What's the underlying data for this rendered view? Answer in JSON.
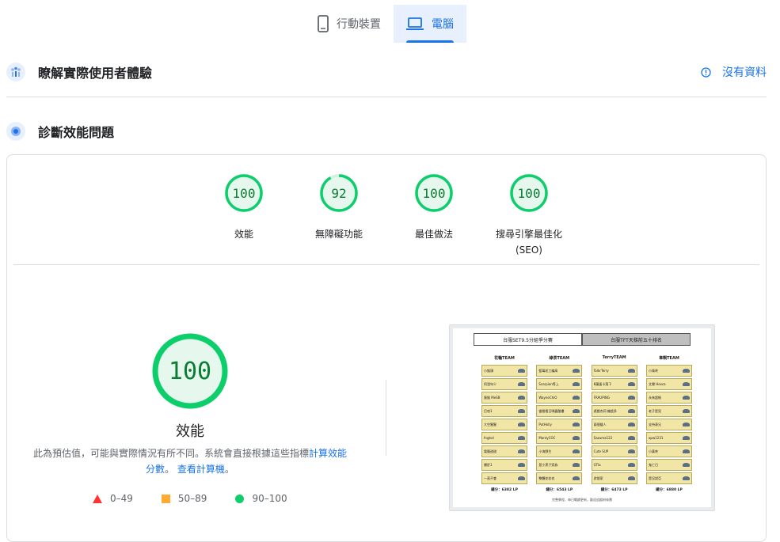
{
  "tabs": [
    {
      "label": "行動裝置",
      "icon": "phone-icon",
      "active": false
    },
    {
      "label": "電腦",
      "icon": "laptop-icon",
      "active": true
    }
  ],
  "field_section": {
    "title": "瞭解實際使用者體驗",
    "status": "沒有資料"
  },
  "lab_section": {
    "title": "診斷效能問題"
  },
  "gauges": [
    {
      "score": "100",
      "label": "效能",
      "value": 100
    },
    {
      "score": "92",
      "label": "無障礙功能",
      "value": 92
    },
    {
      "score": "100",
      "label": "最佳做法",
      "value": 100
    },
    {
      "score": "100",
      "label": "搜尋引擎最佳化",
      "sublabel": "(SEO)",
      "value": 100
    }
  ],
  "main_score": {
    "score": "100",
    "label": "效能",
    "value": 100
  },
  "note": {
    "text": "此為預估值，可能與實際情況有所不同。系統會直接根據這些指標",
    "link1": "計算效能分數",
    "mid": "。",
    "link2": "查看計算機",
    "end": "。"
  },
  "legend": [
    {
      "range": "0–49",
      "color": "#ff3333",
      "shape": "triangle"
    },
    {
      "range": "50–89",
      "color": "#ffaa33",
      "shape": "square"
    },
    {
      "range": "90–100",
      "color": "#0cce6b",
      "shape": "circle"
    }
  ],
  "screenshot": {
    "tab_active": "台服SET9.5分組爭分賽",
    "tab_inactive": "台服TFT天梯前五十排名",
    "teams": [
      {
        "name": "花輪TEAM",
        "total": "總分：6382 LP",
        "players": [
          "小猴頭",
          "阿澄年少",
          "猿猴 MeSB",
          "巴哈1",
          "大空猩猩",
          "fngtsd",
          "電腦甜甜",
          "爆肝1",
          "一直不會"
        ]
      },
      {
        "name": "綠茶TEAM",
        "total": "總分：6543 LP",
        "players": [
          "藍莓初工編高",
          "Scorpion等上",
          "WayneChiO",
          "當看看日嗎露酸樓",
          "PutHolly",
          "MantyCOC",
          "小海野生",
          "是小黑子家族",
          "整體花花也"
        ]
      },
      {
        "name": "TerryTEAM",
        "total": "總分：6473 LP",
        "players": [
          "TolkrTerry",
          "K蘭蛋卡落下",
          "FRAUPING",
          "遊戲杰同 機超多",
          "兩個聲人",
          "Sazuma122",
          "Cute SUP",
          "GTla",
          "對號家"
        ]
      },
      {
        "name": "韋戰TEAM",
        "total": "總分：6880 LP",
        "players": [
          "小鳥咚",
          "艾爾 Hexca",
          "永來超帳",
          "老子是見",
          "支持表兄",
          "apw1231",
          "小黃咚",
          "鬼亡日",
          "是沒說亞"
        ]
      }
    ],
    "footer": "完整賽程、每日戰績更新，歡迎追蹤粉絲團"
  }
}
